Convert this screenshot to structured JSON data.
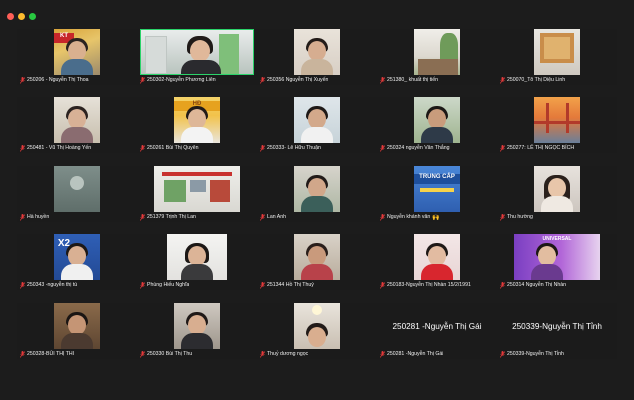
{
  "colors": {
    "window_bg": "#1c1c1c",
    "tile_bg": "#1b1b1b",
    "active_speaker": "#2bd36a",
    "muted_mic": "#e5393a",
    "label_text": "#f0f0f0"
  },
  "participants": [
    {
      "name": "250206 - Nguyễn Thị Thoa",
      "muted": true,
      "video": true
    },
    {
      "name": "250302-Nguyễn Phương Liên",
      "muted": true,
      "video": true,
      "active": true
    },
    {
      "name": "250356 Nguyễn Thị Xuyến",
      "muted": true,
      "video": true
    },
    {
      "name": "251380_ khuất thị tiến",
      "muted": true,
      "video": true
    },
    {
      "name": "250070_Tô Thị Diệu Linh",
      "muted": true,
      "video": true
    },
    {
      "name": "250481 - Vũ Thị Hoàng Yến",
      "muted": true,
      "video": true
    },
    {
      "name": "250261 Bùi Thị Quyên",
      "muted": true,
      "video": true
    },
    {
      "name": "250333- Lê Hữu Thuận",
      "muted": true,
      "video": true
    },
    {
      "name": "250324 nguyễn Văn Thắng",
      "muted": true,
      "video": true
    },
    {
      "name": "250277: LÊ THỊ NGỌC BÍCH",
      "muted": true,
      "video": true
    },
    {
      "name": "Hà huyền",
      "muted": true,
      "video": true
    },
    {
      "name": "251379 Trịnh Thị Lan",
      "muted": true,
      "video": true
    },
    {
      "name": "Lan Anh",
      "muted": true,
      "video": true
    },
    {
      "name": "Nguyễn khánh vân",
      "muted": true,
      "video": true,
      "emoji": "🙌"
    },
    {
      "name": "Thu hường",
      "muted": true,
      "video": true
    },
    {
      "name": "250343 -nguyễn thị tú",
      "muted": true,
      "video": true
    },
    {
      "name": "Phùng Hiếu Nghĩa",
      "muted": true,
      "video": true
    },
    {
      "name": "251344 Hồ Thị Thuý",
      "muted": true,
      "video": true
    },
    {
      "name": "250183-Nguyễn Thị Nhàn 15/2/1991",
      "muted": true,
      "video": true
    },
    {
      "name": "250314 Nguyễn Thị Nhàn",
      "muted": true,
      "video": true
    },
    {
      "name": "250328-BÙI THỊ THI",
      "muted": true,
      "video": true
    },
    {
      "name": "250330 Bùi Thị Thu",
      "muted": true,
      "video": true
    },
    {
      "name": "Thuỷ dương ngọc",
      "muted": true,
      "video": true
    },
    {
      "name": "250281 -Nguyễn Thị Gái",
      "muted": true,
      "video": false,
      "display_name": "250281 -Nguyễn Thị Gái"
    },
    {
      "name": "250339-Nguyễn Thị Tỉnh",
      "muted": true,
      "video": false,
      "display_name": "250339-Nguyễn Thị Tỉnh"
    }
  ]
}
